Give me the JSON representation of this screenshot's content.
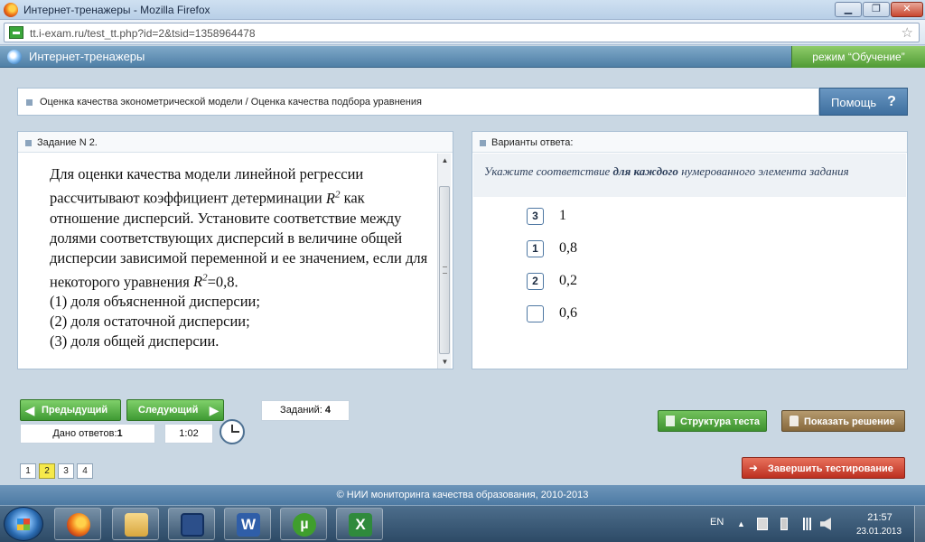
{
  "window": {
    "title": "Интернет-тренажеры - Mozilla Firefox",
    "buttons": {
      "minimize": "▁",
      "maximize": "❐",
      "close": "✕"
    }
  },
  "address_bar": {
    "url": "tt.i-exam.ru/test_tt.php?id=2&tsid=1358964478"
  },
  "app_header": {
    "title": "Интернет-тренажеры",
    "mode": "режим “Обучение”"
  },
  "breadcrumb": {
    "text": "Оценка качества эконометрической модели / Оценка качества подбора уравнения"
  },
  "help_button": {
    "label": "Помощь",
    "icon": "?"
  },
  "task": {
    "header": "Задание N 2.",
    "text_1": "Для оценки качества модели линейной регрессии рассчитывают коэффициент детерминации",
    "r": "R",
    "sup": "2",
    "text_2": " как отношение дисперсий. Установите соответствие между долями соответствующих дисперсий в величине общей дисперсии зависимой переменной и ее значением, если для некоторого уравнения ",
    "text_3": "=0,8.",
    "items": [
      "(1) доля объясненной дисперсии;",
      "(2) доля остаточной дисперсии;",
      "(3) доля общей дисперсии."
    ]
  },
  "answers": {
    "header": "Варианты ответа:",
    "instruction_pre": "Укажите соответствие ",
    "instruction_bold": "для каждого",
    "instruction_post": " нумерованного элемента задания",
    "options": [
      {
        "mark": "3",
        "value": "1"
      },
      {
        "mark": "1",
        "value": "0,8"
      },
      {
        "mark": "2",
        "value": "0,2"
      },
      {
        "mark": "",
        "value": "0,6"
      }
    ]
  },
  "nav": {
    "prev_label": "Предыдущий",
    "next_label": "Следующий",
    "answered_label": "Дано ответов:",
    "answered_value": "1",
    "timer": "1:02",
    "tasks_label": "Заданий:",
    "tasks_value": "4",
    "pages": [
      "1",
      "2",
      "3",
      "4"
    ],
    "current_page": "2"
  },
  "actions": {
    "structure": "Структура теста",
    "solution": "Показать решение",
    "finish": "Завершить тестирование"
  },
  "footer": {
    "copyright": "© НИИ мониторинга качества образования, 2010-2013"
  },
  "taskbar": {
    "lang": "EN",
    "time": "21:57",
    "date": "23.01.2013",
    "word_glyph": "W",
    "torrent_glyph": "µ",
    "excel_glyph": "X"
  },
  "icons": {
    "window": "firefox-icon",
    "site": "site-favicon-icon",
    "bookmark": "star-icon",
    "help": "question-icon",
    "clock": "clock-icon"
  },
  "colors": {
    "accent_green": "#4f9a34",
    "header_blue": "#4f7fa6",
    "finish_red": "#bc2f20",
    "current_page_yellow": "#f6e94a"
  }
}
